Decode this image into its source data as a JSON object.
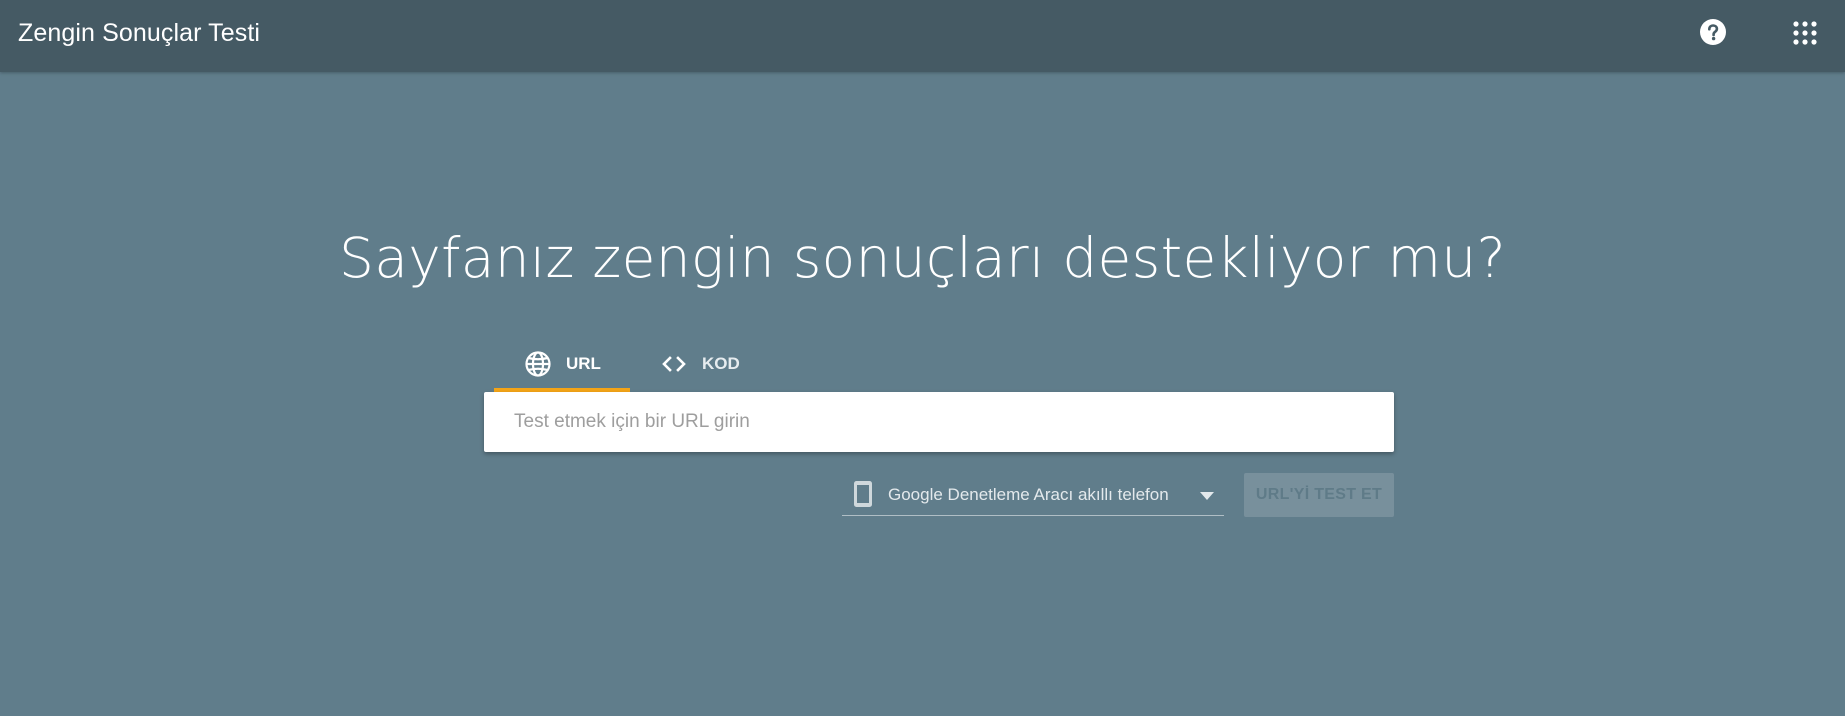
{
  "header": {
    "title": "Zengin Sonuçlar Testi",
    "help_icon": "help-circle-icon",
    "apps_icon": "apps-grid-icon"
  },
  "main": {
    "headline": "Sayfanız zengin sonuçları destekliyor mu?",
    "tabs": [
      {
        "label": "URL",
        "icon": "globe-icon",
        "active": true
      },
      {
        "label": "KOD",
        "icon": "code-icon",
        "active": false
      }
    ],
    "url_input": {
      "placeholder": "Test etmek için bir URL girin",
      "value": ""
    },
    "device_select": {
      "selected": "Google Denetleme Aracı akıllı telefon",
      "icon": "smartphone-icon"
    },
    "test_button": {
      "label": "URL'Yİ TEST ET",
      "enabled": false
    }
  },
  "colors": {
    "page_bg": "#607d8b",
    "header_bg": "#455a64",
    "active_tab_accent": "#f4a417",
    "disabled_button_bg": "#78909c"
  }
}
